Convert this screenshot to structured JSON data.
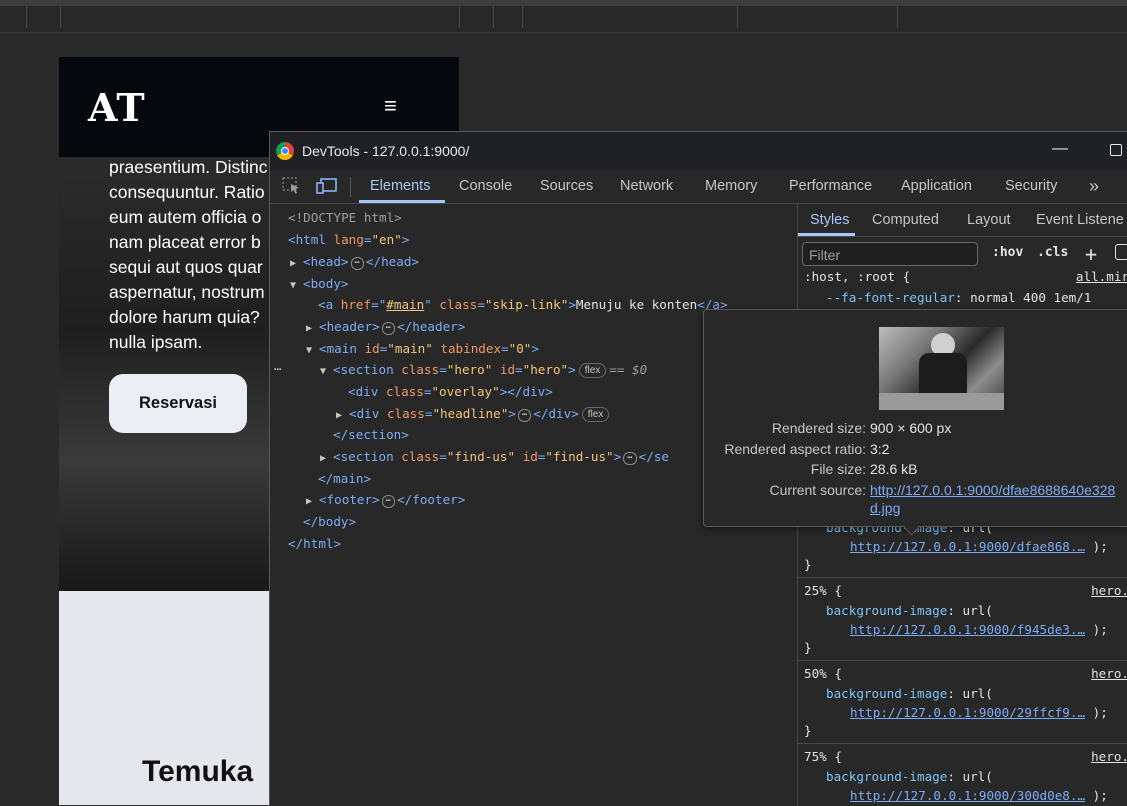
{
  "site": {
    "logo": "AT",
    "menu_icon": "≡",
    "hero_lines": [
      "praesentium. Distinc",
      "consequuntur. Ratio",
      "eum autem officia o",
      "nam placeat error b",
      "sequi aut quos quar",
      "aspernatur, nostrum",
      "dolore harum quia?",
      "nulla ipsam."
    ],
    "reserve_button": "Reservasi",
    "find_title": "Temuka"
  },
  "devtools": {
    "window_title": "DevTools - 127.0.0.1:9000/",
    "tabs": [
      "Elements",
      "Console",
      "Sources",
      "Network",
      "Memory",
      "Performance",
      "Application",
      "Security"
    ],
    "more_tabs": "»",
    "dom": {
      "doctype": "<!DOCTYPE html>",
      "html_open": "<html",
      "lang_attr": "lang",
      "lang_val": "\"en\"",
      "head_open": "<head>",
      "head_close": "</head>",
      "body_open": "<body>",
      "a_open": "<a",
      "href_attr": "href",
      "href_val": "#main",
      "class_attr": "class",
      "skip_class": "\"skip-link\"",
      "skip_text": "Menuju ke konten",
      "a_close": "</a>",
      "header_open": "<header>",
      "header_close": "</header>",
      "main_open": "<main",
      "id_attr": "id",
      "main_id": "\"main\"",
      "tabindex_attr": "tabindex",
      "tabindex_val": "\"0\"",
      "section_open": "<section",
      "hero_class": "\"hero\"",
      "hero_id": "\"hero\"",
      "flex_badge": "flex",
      "selected_marker": "== $0",
      "div_open": "<div",
      "overlay_class": "\"overlay\"",
      "div_close": "</div>",
      "headline_class": "\"headline\"",
      "section_close": "</section>",
      "findus_class": "\"find-us\"",
      "findus_id": "\"find-us\"",
      "findus_close": "</se",
      "main_close": "</main>",
      "footer_open": "<footer>",
      "footer_close": "</footer>",
      "body_close": "</body>",
      "html_close": "</html>",
      "ellipsis": "⋯"
    },
    "styles": {
      "tabs": [
        "Styles",
        "Computed",
        "Layout",
        "Event Listene"
      ],
      "filter_placeholder": "Filter",
      "hov": ":hov",
      "cls": ".cls",
      "host_selector": ":host, :root {",
      "host_source": "all.mir",
      "fa_prop": "--fa-font-regular",
      "fa_val": "normal 400 1em/1",
      "bg_prop": "background-image",
      "url_fn": "url(",
      "close_paren": ");",
      "close_brace": "}",
      "rules": [
        {
          "selector": "25% {",
          "source": "hero.",
          "url": "http://127.0.0.1:9000/f945de3.…"
        },
        {
          "selector": "50% {",
          "source": "hero.",
          "url": "http://127.0.0.1:9000/29ffcf9.…"
        },
        {
          "selector": "75% {",
          "source": "hero.",
          "url": "http://127.0.0.1:9000/300d0e8.…"
        }
      ],
      "first_url": "http://127.0.0.1:9000/dfae868.…"
    },
    "tooltip": {
      "rendered_size_label": "Rendered size:",
      "rendered_size": "900 × 600 px",
      "aspect_label": "Rendered aspect ratio:",
      "aspect": "3:2",
      "file_size_label": "File size:",
      "file_size": "28.6 kB",
      "source_label": "Current source:",
      "source_url_1": "http://127.0.0.1:9000/dfae8688640e328",
      "source_url_2": "d.jpg"
    }
  }
}
